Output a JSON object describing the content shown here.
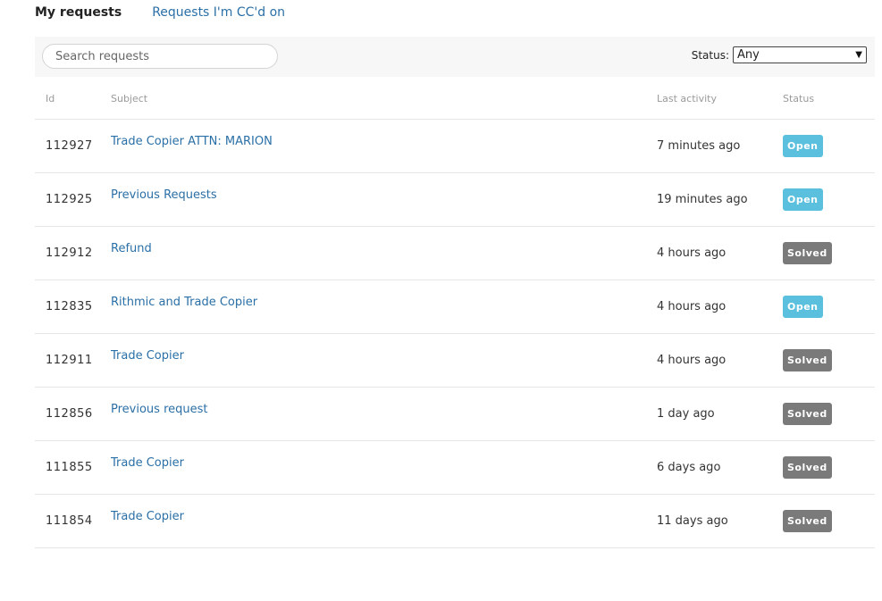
{
  "tabs": {
    "active": "My requests",
    "other": "Requests I'm CC'd on"
  },
  "filters": {
    "search_placeholder": "Search requests",
    "status_label": "Status:",
    "status_value": "Any"
  },
  "table": {
    "headers": {
      "id": "Id",
      "subject": "Subject",
      "last_activity": "Last activity",
      "status": "Status"
    },
    "rows": [
      {
        "id": "112927",
        "subject": "Trade Copier ATTN: MARION",
        "last_activity": "7 minutes ago",
        "status": "Open"
      },
      {
        "id": "112925",
        "subject": "Previous Requests",
        "last_activity": "19 minutes ago",
        "status": "Open"
      },
      {
        "id": "112912",
        "subject": "Refund",
        "last_activity": "4 hours ago",
        "status": "Solved"
      },
      {
        "id": "112835",
        "subject": "Rithmic and Trade Copier",
        "last_activity": "4 hours ago",
        "status": "Open"
      },
      {
        "id": "112911",
        "subject": "Trade Copier",
        "last_activity": "4 hours ago",
        "status": "Solved"
      },
      {
        "id": "112856",
        "subject": "Previous request",
        "last_activity": "1 day ago",
        "status": "Solved"
      },
      {
        "id": "111855",
        "subject": "Trade Copier",
        "last_activity": "6 days ago",
        "status": "Solved"
      },
      {
        "id": "111854",
        "subject": "Trade Copier",
        "last_activity": "11 days ago",
        "status": "Solved"
      }
    ]
  },
  "colors": {
    "link": "#2a6fa6",
    "open_badge": "#5bbfde",
    "solved_badge": "#7a7a7a",
    "filter_bar_bg": "#f7f7f7"
  }
}
